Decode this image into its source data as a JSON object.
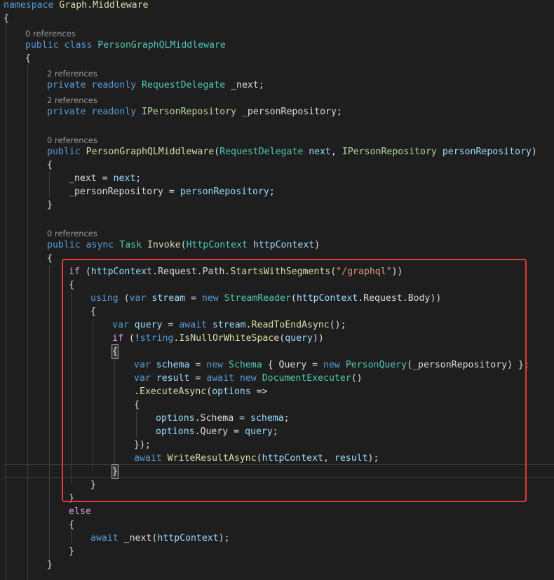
{
  "codelens": {
    "class_refs": "0 references",
    "next_refs": "2 references",
    "repo_refs": "2 references",
    "ctor_refs": "0 references",
    "invoke_refs": "0 references"
  },
  "code": {
    "l1": [
      "namespace",
      " ",
      "Graph.Middleware"
    ],
    "l2": [
      "{"
    ],
    "l3": [
      "public",
      " ",
      "class",
      " ",
      "PersonGraphQLMiddleware"
    ],
    "l4": [
      "{"
    ],
    "l5": [
      "private",
      " ",
      "readonly",
      " ",
      "RequestDelegate",
      " ",
      "_next;"
    ],
    "l6": [
      "private",
      " ",
      "readonly",
      " ",
      "IPersonRepository",
      " ",
      "_personRepository;"
    ],
    "l7": [
      "public",
      " ",
      "PersonGraphQLMiddleware",
      "(",
      "RequestDelegate",
      " ",
      "next",
      ", ",
      "IPersonRepository",
      " ",
      "personRepository",
      ")"
    ],
    "l8": [
      "{"
    ],
    "l9": [
      "_next",
      " = ",
      "next",
      ";"
    ],
    "l10": [
      "_personRepository",
      " = ",
      "personRepository",
      ";"
    ],
    "l11": [
      "}"
    ],
    "l12": [
      "public",
      " ",
      "async",
      " ",
      "Task",
      " ",
      "Invoke",
      "(",
      "HttpContext",
      " ",
      "httpContext",
      ")"
    ],
    "l13": [
      "{"
    ],
    "l14": [
      "if",
      " (",
      "httpContext",
      ".",
      "Request",
      ".",
      "Path",
      ".",
      "StartsWithSegments",
      "(",
      "\"/graphql\"",
      "))"
    ],
    "l15": [
      "{"
    ],
    "l16": [
      "using",
      " (",
      "var",
      " ",
      "stream",
      " = ",
      "new",
      " ",
      "StreamReader",
      "(",
      "httpContext",
      ".",
      "Request",
      ".",
      "Body",
      "))"
    ],
    "l17": [
      "{"
    ],
    "l18": [
      "var",
      " ",
      "query",
      " = ",
      "await",
      " ",
      "stream",
      ".",
      "ReadToEndAsync",
      "();"
    ],
    "l19": [
      "if",
      " (!",
      "string",
      ".",
      "IsNullOrWhiteSpace",
      "(",
      "query",
      "))"
    ],
    "l20": [
      "{"
    ],
    "l21": [
      "var",
      " ",
      "schema",
      " = ",
      "new",
      " ",
      "Schema",
      " { ",
      "Query",
      " = ",
      "new",
      " ",
      "PersonQuery",
      "(",
      "_personRepository",
      ") };"
    ],
    "l22": [
      "var",
      " ",
      "result",
      " = ",
      "await",
      " ",
      "new",
      " ",
      "DocumentExecuter",
      "()"
    ],
    "l23": [
      ".",
      "ExecuteAsync",
      "(",
      "options",
      " =>"
    ],
    "l24": [
      "{"
    ],
    "l25": [
      "options",
      ".",
      "Schema",
      " = ",
      "schema",
      ";"
    ],
    "l26": [
      "options",
      ".",
      "Query",
      " = ",
      "query",
      ";"
    ],
    "l27": [
      "});"
    ],
    "l28": [
      "await",
      " ",
      "WriteResultAsync",
      "(",
      "httpContext",
      ", ",
      "result",
      ");"
    ],
    "l29": [
      "}"
    ],
    "l30": [
      "}"
    ],
    "l31": [
      "}"
    ],
    "l32": [
      "else"
    ],
    "l33": [
      "{"
    ],
    "l34": [
      "await",
      " ",
      "_next",
      "(",
      "httpContext",
      ");"
    ],
    "l35": [
      "}"
    ],
    "l36": [
      "}"
    ]
  },
  "colors": {
    "background": "#1e1e1e",
    "keyword": "#569cd6",
    "control_keyword": "#d8a0df",
    "type": "#4ec9b0",
    "interface": "#b8d7a3",
    "method": "#dcdcaa",
    "string": "#d69d85",
    "parameter": "#9cdcfe",
    "highlight_box": "#e03a3a"
  }
}
